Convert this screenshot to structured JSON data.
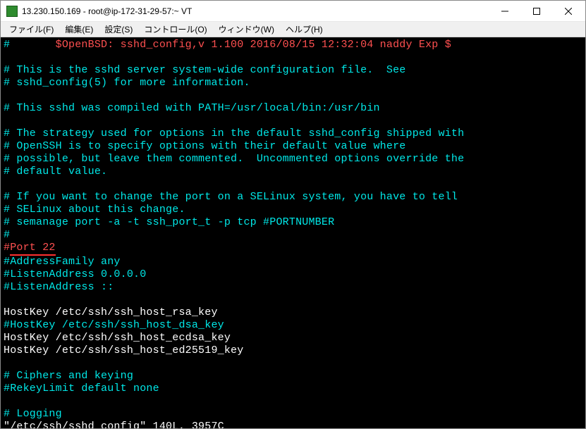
{
  "window": {
    "title": "13.230.150.169 - root@ip-172-31-29-57:~ VT"
  },
  "menu": {
    "file": "ファイル(F)",
    "edit": "編集(E)",
    "settings": "設定(S)",
    "control": "コントロール(O)",
    "window": "ウィンドウ(W)",
    "help": "ヘルプ(H)"
  },
  "terminal": {
    "l01a": "#",
    "l01b": "       $OpenBSD: sshd_config,v 1.100 2016/08/15 12:32:04 naddy Exp $",
    "l02": "",
    "l03": "# This is the sshd server system-wide configuration file.  See",
    "l04": "# sshd_config(5) for more information.",
    "l05": "",
    "l06": "# This sshd was compiled with PATH=/usr/local/bin:/usr/bin",
    "l07": "",
    "l08": "# The strategy used for options in the default sshd_config shipped with",
    "l09": "# OpenSSH is to specify options with their default value where",
    "l10": "# possible, but leave them commented.  Uncommented options override the",
    "l11": "# default value.",
    "l12": "",
    "l13": "# If you want to change the port on a SELinux system, you have to tell",
    "l14": "# SELinux about this change.",
    "l15": "# semanage port -a -t ssh_port_t -p tcp #PORTNUMBER",
    "l16": "#",
    "l17a": "#",
    "l17b": "Port 22",
    "l18": "#AddressFamily any",
    "l19": "#ListenAddress 0.0.0.0",
    "l20": "#ListenAddress ::",
    "l21": "",
    "l22": "HostKey /etc/ssh/ssh_host_rsa_key",
    "l23": "#HostKey /etc/ssh/ssh_host_dsa_key",
    "l24": "HostKey /etc/ssh/ssh_host_ecdsa_key",
    "l25": "HostKey /etc/ssh/ssh_host_ed25519_key",
    "l26": "",
    "l27": "# Ciphers and keying",
    "l28": "#RekeyLimit default none",
    "l29": "",
    "l30": "# Logging",
    "status": "\"/etc/ssh/sshd_config\" 140L, 3957C"
  }
}
